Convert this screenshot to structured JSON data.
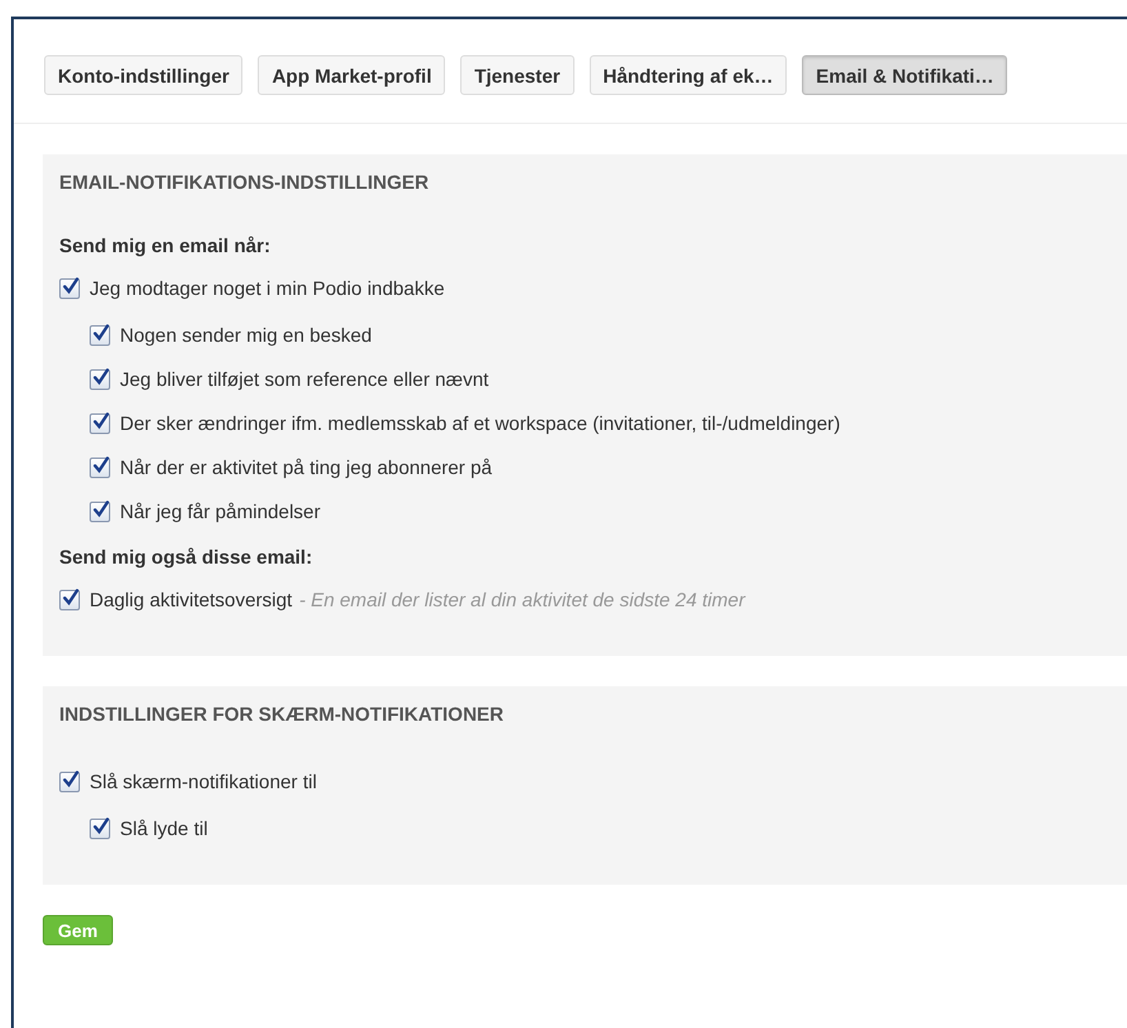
{
  "tabs": [
    {
      "label": "Konto-indstillinger",
      "selected": false
    },
    {
      "label": "App Market-profil",
      "selected": false
    },
    {
      "label": "Tjenester",
      "selected": false
    },
    {
      "label": "Håndtering af ek…",
      "selected": false
    },
    {
      "label": "Email & Notifikati…",
      "selected": true
    }
  ],
  "sections": [
    {
      "title": "EMAIL-NOTIFIKATIONS-INDSTILLINGER",
      "groups": [
        {
          "heading": "Send mig en email når:",
          "options": [
            {
              "label": "Jeg modtager noget i min Podio indbakke",
              "checked": true,
              "children": [
                {
                  "label": "Nogen sender mig en besked",
                  "checked": true
                },
                {
                  "label": "Jeg bliver tilføjet som reference eller nævnt",
                  "checked": true
                },
                {
                  "label": "Der sker ændringer ifm. medlemsskab af et workspace (invitationer, til-/udmeldinger)",
                  "checked": true
                },
                {
                  "label": "Når der er aktivitet på ting jeg abonnerer på",
                  "checked": true
                },
                {
                  "label": "Når jeg får påmindelser",
                  "checked": true
                }
              ]
            }
          ]
        },
        {
          "heading": "Send mig også disse email:",
          "options": [
            {
              "label": "Daglig aktivitetsoversigt",
              "checked": true,
              "description": "- En email der lister al din aktivitet de sidste 24 timer"
            }
          ]
        }
      ]
    },
    {
      "title": "INDSTILLINGER FOR SKÆRM-NOTIFIKATIONER",
      "groups": [
        {
          "options": [
            {
              "label": "Slå skærm-notifikationer til",
              "checked": true,
              "children": [
                {
                  "label": "Slå lyde til",
                  "checked": true
                }
              ]
            }
          ]
        }
      ]
    }
  ],
  "save_button": "Gem"
}
